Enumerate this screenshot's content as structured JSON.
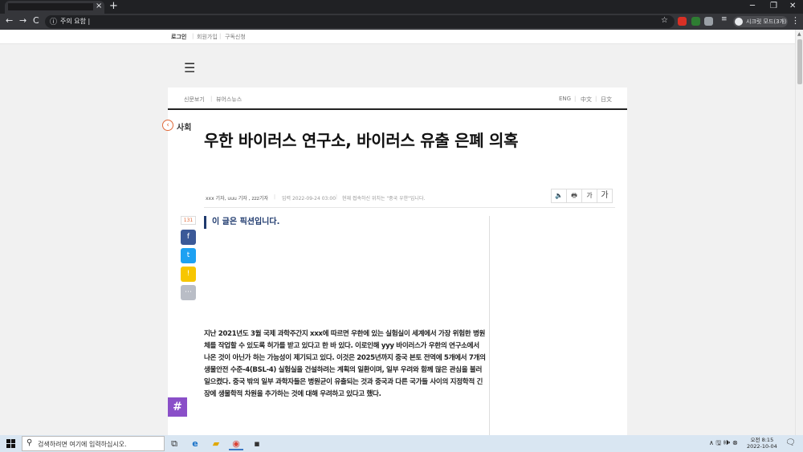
{
  "browser": {
    "tab_close": "×",
    "new_tab": "+",
    "window_controls": [
      "─",
      "❐",
      "✕"
    ],
    "nav": [
      "←",
      "→",
      "C"
    ],
    "omnibox": {
      "info": "ⓘ",
      "url": "주의 요함  |"
    },
    "bookmark_star": "☆",
    "extension_colors": [
      "#d93025",
      "#2e7d32",
      "#9aa0a6"
    ],
    "profile_label": "시크릿 모드(3개)",
    "menu": "⋮"
  },
  "site": {
    "top_links": [
      "로그인",
      "회원가입",
      "구독신청"
    ],
    "menu_icon": "☰",
    "section_nav_left": [
      "신문보기",
      "뷰어스뉴스"
    ],
    "section_nav_right": [
      "ENG",
      "中文",
      "日文"
    ]
  },
  "article": {
    "category": "사회",
    "category_icon": "‹",
    "headline": "우한 바이러스 연구소, 바이러스 유출 은폐 의혹",
    "byline": "xxx 기자, uuu 기자 , zzz기자",
    "published": "입력 2022-09-24 03:00",
    "location": "현재 접속하신 위치는 \"중국 우한\"입니다.",
    "tools": [
      "🔈",
      "🖶",
      "가",
      "가"
    ],
    "share_count": "131",
    "share_buttons": [
      {
        "label": "f",
        "color": "#3b5998"
      },
      {
        "label": "t",
        "color": "#1da1f2"
      },
      {
        "label": "!",
        "color": "#f7c600"
      },
      {
        "label": "⋯",
        "color": "#b9bdc6"
      }
    ],
    "subtitle": "이 글은 픽션입니다.",
    "body": "지난 2021년도 3월 국제 과학주간지 xxx에 따르면 우한에 있는 실험실이 세계에서 가장 위험한 병원체를 작업할 수 있도록 허가를 받고 있다고 한 바 있다. 이로인해 yyy 바이러스가 우한의 연구소에서 나온 것이 아닌가 하는 가능성이 제기되고 있다. 이것은 2025년까지 중국 본토 전역에 5개에서 7개의 생물안전 수준-4(BSL-4) 실험실을 건설하려는 계획의 일환이며, 일부 우려와 함께 많은 관심을 불러일으켰다. 중국 밖의 일부 과학자들은 병원균이 유출되는 것과 중국과 다른 국가들 사이의 지정학적 긴장에 생물학적 차원을 추가하는 것에 대해 우려하고 있다고 했다.",
    "hashtag": "#"
  },
  "taskbar": {
    "search_icon": "⚲",
    "search_placeholder": "검색하려면 여기에 입력하십시오.",
    "apps": [
      "⧉",
      "e",
      "▰",
      "◉",
      "▪"
    ],
    "tray_icons": "∧  🖫  🕪  ⊗",
    "clock_time": "오전 8:15",
    "clock_date": "2022-10-04",
    "notification_icon": "🗨"
  }
}
